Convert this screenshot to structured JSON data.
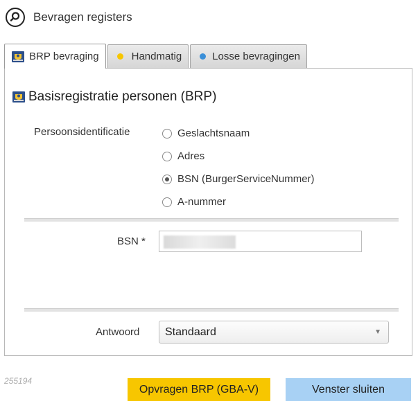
{
  "header": {
    "title": "Bevragen registers"
  },
  "tabs": [
    {
      "label": "BRP bevraging",
      "active": true
    },
    {
      "label": "Handmatig",
      "dot_color": "#f7c600"
    },
    {
      "label": "Losse bevragingen",
      "dot_color": "#3a8fd8"
    }
  ],
  "panel": {
    "title": "Basisregistratie personen (BRP)",
    "identification_label": "Persoonsidentificatie",
    "radio_options": [
      {
        "label": "Geslachtsnaam",
        "checked": false
      },
      {
        "label": "Adres",
        "checked": false
      },
      {
        "label": "BSN (BurgerServiceNummer)",
        "checked": true
      },
      {
        "label": "A-nummer",
        "checked": false
      }
    ],
    "bsn_label": "BSN *",
    "bsn_value": "",
    "answer_label": "Antwoord",
    "answer_value": "Standaard"
  },
  "footer": {
    "id": "255194",
    "primary_button": "Opvragen BRP (GBA-V)",
    "secondary_button": "Venster sluiten"
  },
  "colors": {
    "primary_button": "#f7c600",
    "secondary_button": "#a8d1f4"
  }
}
